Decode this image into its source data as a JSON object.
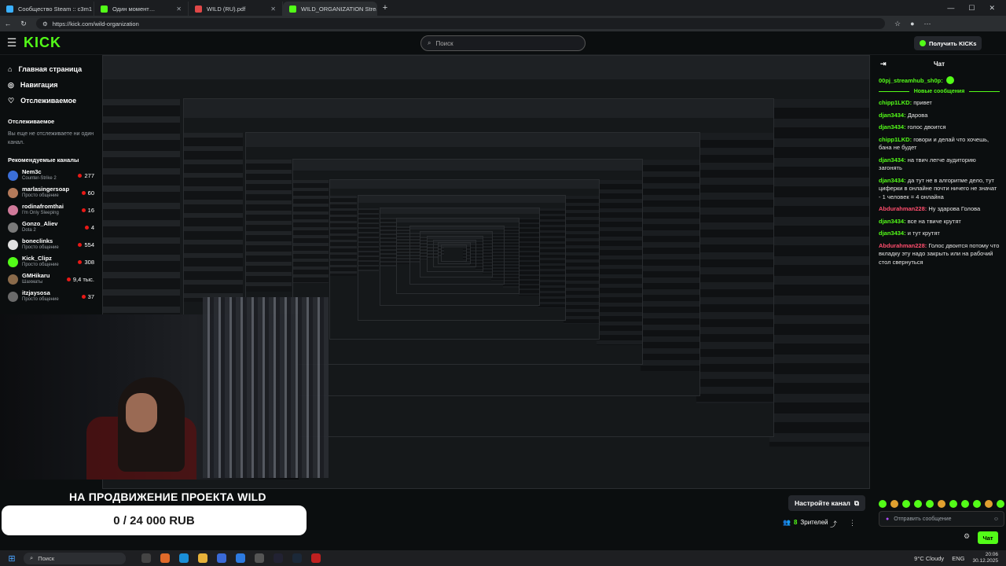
{
  "browser": {
    "tabs": [
      {
        "title": "Сообщество Steam :: c3m1",
        "active": false
      },
      {
        "title": "Один момент…",
        "active": false
      },
      {
        "title": "WILD (RU).pdf",
        "active": false
      },
      {
        "title": "WILD_ORGANIZATION Stream - W",
        "active": true
      }
    ],
    "new_tab": "+",
    "url": "https://kick.com/wild-organization"
  },
  "kick": {
    "logo": "KICK",
    "search_placeholder": "Поиск",
    "get_kicks": "Получить KICKs"
  },
  "sidebar": {
    "nav": [
      {
        "label": "Главная страница",
        "icon": "home-icon"
      },
      {
        "label": "Навигация",
        "icon": "compass-icon"
      },
      {
        "label": "Отслеживаемое",
        "icon": "heart-icon"
      }
    ],
    "following_title": "Отслеживаемое",
    "following_empty": "Вы еще не отслеживаете ни один канал.",
    "recommended_title": "Рекомендуемые каналы",
    "channels": [
      {
        "name": "Nem3c",
        "game": "Counter-Strike 2",
        "viewers": "277",
        "color": "#3b6fd8"
      },
      {
        "name": "marlasingersoap",
        "game": "Просто общение",
        "viewers": "60",
        "color": "#b47a5a"
      },
      {
        "name": "rodinafromthai",
        "game": "I'm Only Sleeping",
        "viewers": "16",
        "color": "#d07a9a"
      },
      {
        "name": "Gonzo_Aliev",
        "game": "Dota 2",
        "viewers": "4",
        "color": "#7a7a7a"
      },
      {
        "name": "boneclinks",
        "game": "Просто общение",
        "viewers": "554",
        "color": "#e0e0e0"
      },
      {
        "name": "Kick_Clipz",
        "game": "Просто общение",
        "viewers": "308",
        "color": "#53fc18"
      },
      {
        "name": "GMHikaru",
        "game": "Шахматы",
        "viewers": "9,4 тыс.",
        "color": "#8a6a4a"
      },
      {
        "name": "itzjaysosa",
        "game": "Просто общение",
        "viewers": "37",
        "color": "#6a6a6a"
      }
    ]
  },
  "chat": {
    "title": "Чат",
    "pinned_user": "00pj_streamhub_sh0p:",
    "new_messages": "Новые сообщения",
    "messages": [
      {
        "user": "chipp1LKD:",
        "text": "привет",
        "color": "#53fc18"
      },
      {
        "user": "djan3434:",
        "text": "Дарова",
        "color": "#53fc18"
      },
      {
        "user": "djan3434:",
        "text": "голос двоится",
        "color": "#53fc18"
      },
      {
        "user": "chipp1LKD:",
        "text": "говори и делай что хочешь, бана не будет",
        "color": "#53fc18"
      },
      {
        "user": "djan3434:",
        "text": "на твич легче аудиторию загонять",
        "color": "#53fc18"
      },
      {
        "user": "djan3434:",
        "text": "да тут не в алгоритме дело, тут циферки в онлайне почти ничего не значат - 1 человек = 4 онлайна",
        "color": "#53fc18"
      },
      {
        "user": "Abdurahman228:",
        "text": "Ну здарова Голова",
        "color": "#ff4d6d"
      },
      {
        "user": "djan3434:",
        "text": "все на твиче крутят",
        "color": "#53fc18"
      },
      {
        "user": "djan3434:",
        "text": "и тут крутят",
        "color": "#53fc18"
      },
      {
        "user": "Abdurahman228:",
        "text": "Голос двоится потому что вкладку эту надо закрыть или на рабочий стол свернуться",
        "color": "#ff4d6d"
      }
    ],
    "input_placeholder": "Отправить сообщение",
    "send": "Чат"
  },
  "overlay": {
    "goal_title": "НА ПРОДВИЖЕНИЕ ПРОЕКТА WILD",
    "goal_value": "0 / 24 000 RUB"
  },
  "stream_controls": {
    "setup_channel": "Настройте канал",
    "viewers_count": "8",
    "viewers_label": "Зрителей"
  },
  "taskbar": {
    "search": "Поиск",
    "weather": "9°C  Cloudy",
    "lang": "ENG",
    "time": "20:06",
    "date": "30.12.2025"
  },
  "colors": {
    "accent": "#53fc18",
    "bg": "#0b0e0f"
  }
}
